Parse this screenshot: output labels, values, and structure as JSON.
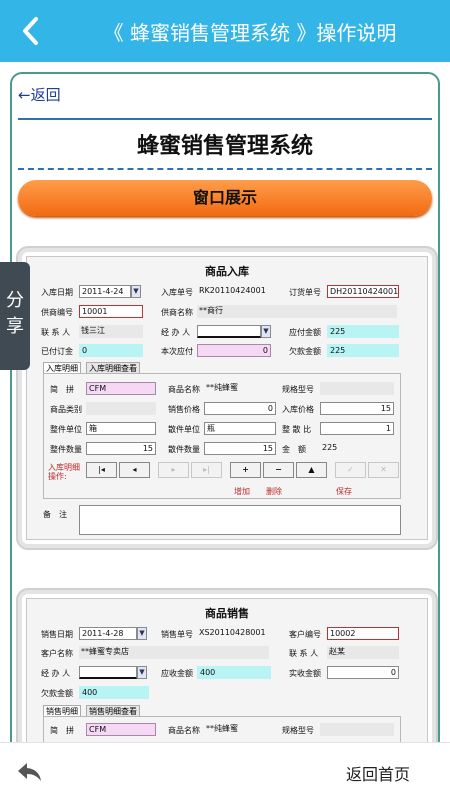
{
  "header": {
    "title": "《 蜂蜜销售管理系统 》操作说明",
    "back_icon": "chevron-left-icon"
  },
  "content": {
    "back_link": "←返回",
    "doc_title": "蜂蜜销售管理系统",
    "section_title": "窗口展示",
    "share_label": [
      "分",
      "享"
    ],
    "inbound": {
      "title": "商品入库",
      "row1": {
        "date_label": "入库日期",
        "date_value": "2011-4-24",
        "no_label": "入库单号",
        "no_value": "RK20110424001",
        "order_label": "订货单号",
        "order_value": "DH20110424001"
      },
      "row2": {
        "supplier_no_label": "供商编号",
        "supplier_no_value": "10001",
        "supplier_name_label": "供商名称",
        "supplier_name_value": "**商行"
      },
      "row3": {
        "contact_label": "联 系 人",
        "contact_value": "钱三江",
        "handler_label": "经 办 人",
        "handler_value": "",
        "payable_label": "应付金额",
        "payable_value": "225"
      },
      "row4": {
        "deposit_label": "已付订金",
        "deposit_value": "0",
        "current_label": "本次应付",
        "current_value": "0",
        "owed_label": "欠款金额",
        "owed_value": "225"
      },
      "tabs": [
        "入库明细",
        "入库明细查看"
      ],
      "detail": {
        "pinyin_label": "简　拼",
        "pinyin_value": "CFM",
        "goods_name_label": "商品名称",
        "goods_name_value": "**纯蜂蜜",
        "spec_label": "规格型号",
        "spec_value": "",
        "category_label": "商品类别",
        "category_value": "",
        "sale_price_label": "销售价格",
        "sale_price_value": "0",
        "in_price_label": "入库价格",
        "in_price_value": "15",
        "whole_unit_label": "整件单位",
        "whole_unit_value": "箱",
        "loose_unit_label": "散件单位",
        "loose_unit_value": "瓶",
        "ratio_label": "整 散 比",
        "ratio_value": "1",
        "whole_qty_label": "整件数量",
        "whole_qty_value": "15",
        "loose_qty_label": "散件数量",
        "loose_qty_value": "15",
        "amount_label": "金　额",
        "amount_value": "225",
        "ops_label": "入库明细操作:",
        "nav_buttons": [
          "|◂",
          "◂",
          "▸",
          "▸|",
          "+",
          "−",
          "▲",
          "✓",
          "✕"
        ],
        "action_labels": [
          "增加",
          "删除",
          "保存"
        ]
      },
      "remarks_label": "备　注"
    },
    "sales": {
      "title": "商品销售",
      "row1": {
        "date_label": "销售日期",
        "date_value": "2011-4-28",
        "no_label": "销售单号",
        "no_value": "XS20110428001",
        "customer_no_label": "客户编号",
        "customer_no_value": "10002"
      },
      "row2": {
        "customer_name_label": "客户名称",
        "customer_name_value": "**蜂蜜专卖店",
        "contact_label": "联 系 人",
        "contact_value": "赵某"
      },
      "row3": {
        "handler_label": "经 办 人",
        "handler_value": "",
        "receivable_label": "应收金额",
        "receivable_value": "400",
        "received_label": "实收金额",
        "received_value": "0"
      },
      "row4": {
        "owed_label": "欠款金额",
        "owed_value": "400"
      },
      "tabs": [
        "销售明细",
        "销售明细查看"
      ],
      "detail": {
        "pinyin_label": "简　拼",
        "pinyin_value": "CFM",
        "goods_name_label": "商品名称",
        "goods_name_value": "**纯蜂蜜",
        "spec_label": "规格型号",
        "spec_value": ""
      }
    }
  },
  "footer": {
    "home_label": "返回首页",
    "reply_icon": "reply-arrow-icon"
  },
  "colors": {
    "header_bg": "#33b5e8",
    "frame_border": "#4a9a8e",
    "section_bar": "#f26a12",
    "link": "#1e3c9a"
  }
}
